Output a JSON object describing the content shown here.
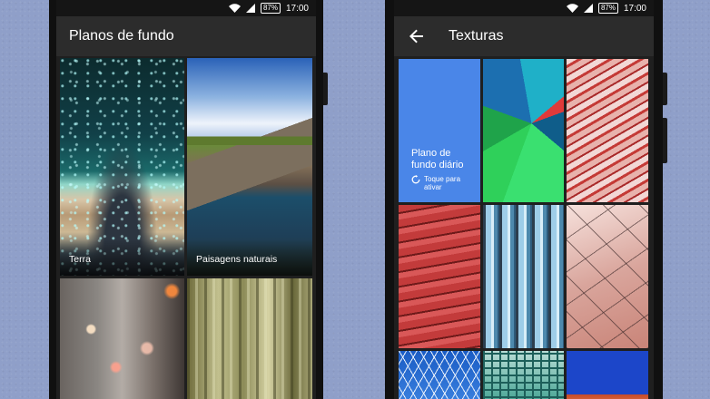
{
  "status_bar": {
    "battery": "87%",
    "time": "17:00"
  },
  "left_screen": {
    "title": "Planos de fundo",
    "categories": [
      {
        "label": "Terra"
      },
      {
        "label": "Paisagens naturais"
      },
      {
        "label": ""
      },
      {
        "label": ""
      }
    ]
  },
  "right_screen": {
    "title": "Texturas",
    "daily": {
      "title": "Plano de fundo diário",
      "subtitle": "Toque para ativar"
    }
  },
  "colors": {
    "appbar": "#2c2c2c",
    "daily_tile": "#4a86e8",
    "background": "#8f9fc9"
  },
  "icons": {
    "back": "arrow-back-icon",
    "refresh": "refresh-icon",
    "wifi": "wifi-icon",
    "signal": "signal-icon"
  }
}
